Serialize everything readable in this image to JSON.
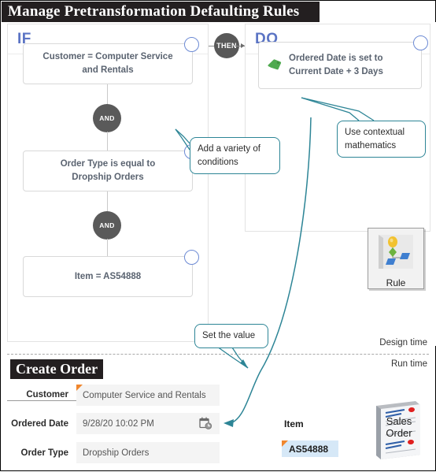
{
  "window": {
    "title": "Manage Pretransformation Defaulting Rules"
  },
  "rule_designer": {
    "if_panel": {
      "heading": "IF",
      "conditions": [
        {
          "text": "Customer = Computer Service and Rentals"
        },
        {
          "text": "Order Type is equal to Dropship Orders"
        },
        {
          "text": "Item = AS54888"
        }
      ],
      "operators": [
        "AND",
        "AND"
      ]
    },
    "connector": {
      "label": "THEN"
    },
    "do_panel": {
      "heading": "DO",
      "actions": [
        {
          "icon": "green-tag-icon",
          "text": "Ordered Date is set to Current Date + 3 Days"
        }
      ]
    }
  },
  "callouts": [
    {
      "id": "add-conditions",
      "text": "Add a variety  of conditions"
    },
    {
      "id": "contextual-math",
      "text": "Use contextual mathematics"
    },
    {
      "id": "set-value",
      "text": "Set the value"
    }
  ],
  "rule_button": {
    "label": "Rule",
    "icon": "rule-flowchart-icon"
  },
  "timeline": {
    "design_time": "Design time",
    "run_time": "Run time"
  },
  "create_order": {
    "title": "Create Order",
    "fields": [
      {
        "label": "Customer",
        "value": "Computer Service and Rentals",
        "required": true,
        "icon": ""
      },
      {
        "label": "Ordered Date",
        "value": "9/28/20 10:02 PM",
        "required": false,
        "icon": "calendar-clock-icon"
      },
      {
        "label": "Order Type",
        "value": "Dropship Orders",
        "required": false,
        "icon": ""
      }
    ],
    "item": {
      "label": "Item",
      "value": "AS54888"
    },
    "sales_order_icon": {
      "line1": "Sales",
      "line2": "Order"
    }
  },
  "colors": {
    "accent_blue": "#5b74c4",
    "callout_teal": "#2d8596",
    "node_gray": "#585858",
    "tag_green": "#4caf50",
    "required_orange": "#f0862d",
    "item_highlight": "#d6e8f7"
  }
}
